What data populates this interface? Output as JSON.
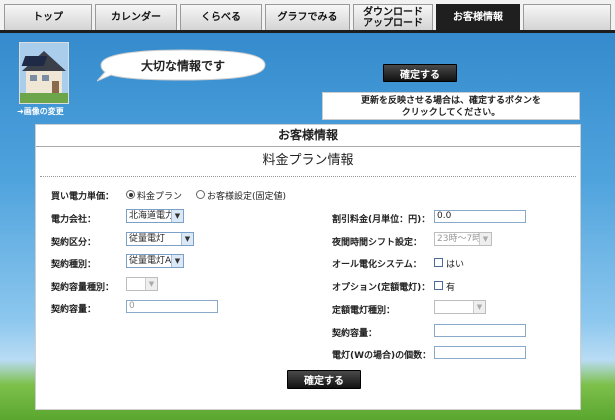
{
  "tabs": [
    {
      "label": "トップ",
      "active": false
    },
    {
      "label": "カレンダー",
      "active": false
    },
    {
      "label": "くらべる",
      "active": false
    },
    {
      "label": "グラフでみる",
      "active": false
    },
    {
      "label_line1": "ダウンロード",
      "label_line2": "アップロード",
      "active": false
    },
    {
      "label": "お客様情報",
      "active": true
    },
    {
      "label": "",
      "active": false
    }
  ],
  "header": {
    "bubble_text": "大切な情報です",
    "photo_change_label": "➜画像の変更",
    "confirm_button": "確定する",
    "confirm_note_line1": "更新を反映させる場合は、確定するボタンを",
    "confirm_note_line2": "クリックしてください。"
  },
  "card": {
    "title": "お客様情報",
    "subtitle": "料金プラン情報",
    "purchase_unit_label": "買い電力単価：",
    "radio_plan_label": "料金プラン",
    "radio_custom_label": "お客様設定(固定値)",
    "left": {
      "power_company_label": "電力会社：",
      "power_company_value": "北海道電力",
      "contract_class_label": "契約区分：",
      "contract_class_value": "従量電灯",
      "contract_type_label": "契約種別：",
      "contract_type_value": "従量電灯A",
      "capacity_type_label": "契約容量種別：",
      "capacity_type_value": "",
      "capacity_label": "契約容量：",
      "capacity_placeholder": "0"
    },
    "right": {
      "discount_label": "割引料金(月単位：円)：",
      "discount_value": "0.0",
      "night_shift_label": "夜間時間シフト設定：",
      "night_shift_value": "23時～7時",
      "all_electric_label": "オール電化システム：",
      "all_electric_option": "はい",
      "option_label": "オプション(定額電灯)：",
      "option_value": "有",
      "flat_type_label": "定額電灯種別：",
      "flat_type_value": "",
      "flat_capacity_label": "契約容量：",
      "flat_capacity_value": "",
      "lamp_count_label": "電灯(Wの場合)の個数：",
      "lamp_count_value": ""
    },
    "confirm_button": "確定する"
  },
  "colors": {
    "sky_top": "#2f85c9",
    "grass": "#5aa62f",
    "active_tab": "#1f1f1f"
  }
}
